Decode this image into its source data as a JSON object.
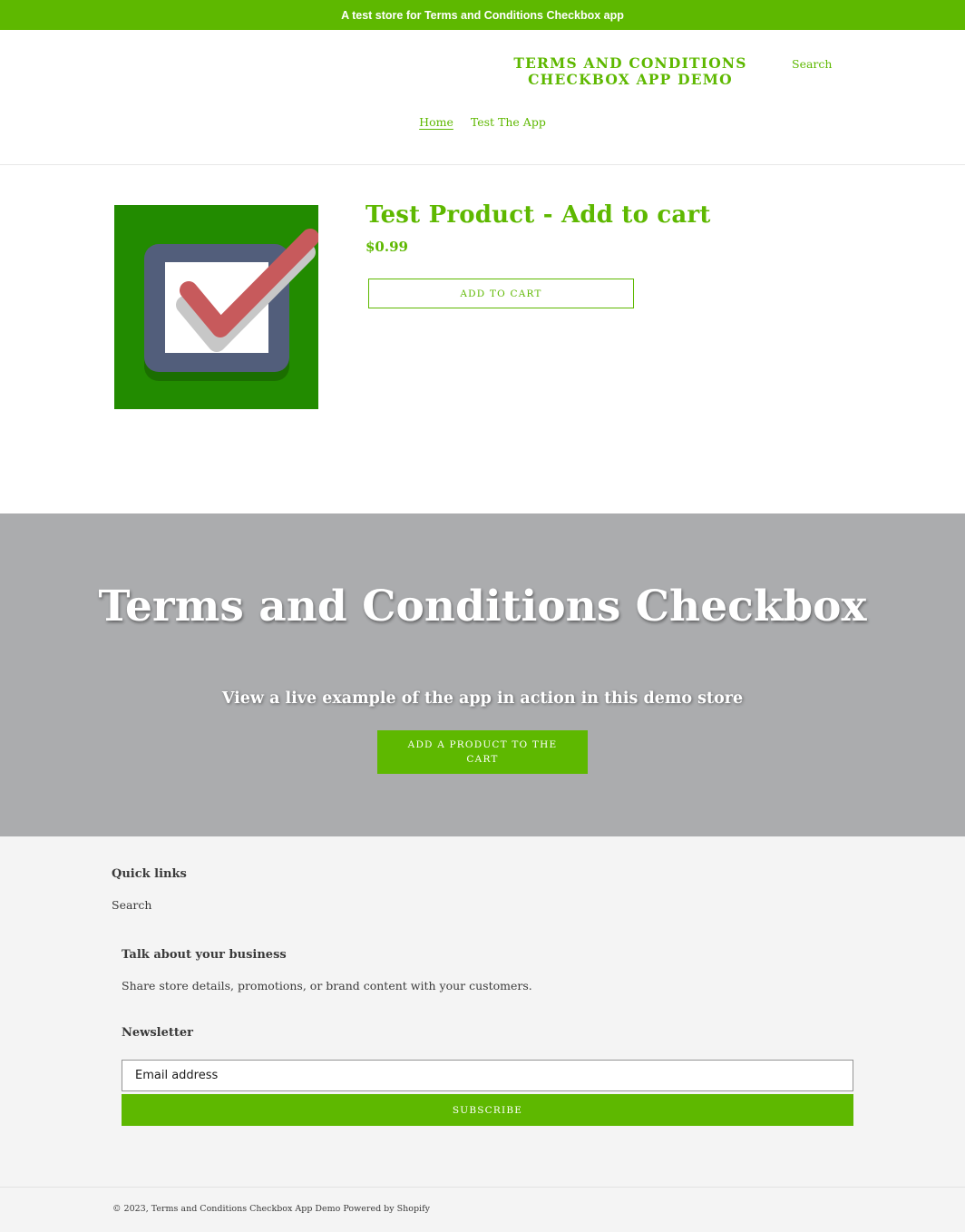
{
  "announcement": "A test store for Terms and Conditions Checkbox app",
  "header": {
    "site_title": "TERMS AND CONDITIONS CHECKBOX APP DEMO",
    "search_label": "Search"
  },
  "nav": {
    "items": [
      {
        "label": "Home",
        "active": true
      },
      {
        "label": "Test The App",
        "active": false
      }
    ]
  },
  "product": {
    "image_icon": "checkbox-checkmark-icon",
    "title": "Test Product - Add to cart",
    "price": "$0.99",
    "add_to_cart_label": "Add to cart"
  },
  "hero": {
    "title": "Terms and Conditions Checkbox",
    "subtitle": "View a live example of the app in action in this demo store",
    "button_label": "Add a product to the cart"
  },
  "footer": {
    "quick_links_heading": "Quick links",
    "quick_links": [
      "Search"
    ],
    "business_heading": "Talk about your business",
    "business_text": "Share store details, promotions, or brand content with your customers.",
    "newsletter_heading": "Newsletter",
    "email_placeholder": "Email address",
    "subscribe_label": "Subscribe",
    "copyright_prefix": "© 2023,",
    "copyright_store": "Terms and Conditions Checkbox App Demo",
    "powered_by": "Powered by Shopify"
  },
  "colors": {
    "accent": "#5eb800",
    "hero_bg": "#abacae",
    "footer_bg": "#f4f4f4",
    "image_bg": "#228b00"
  }
}
